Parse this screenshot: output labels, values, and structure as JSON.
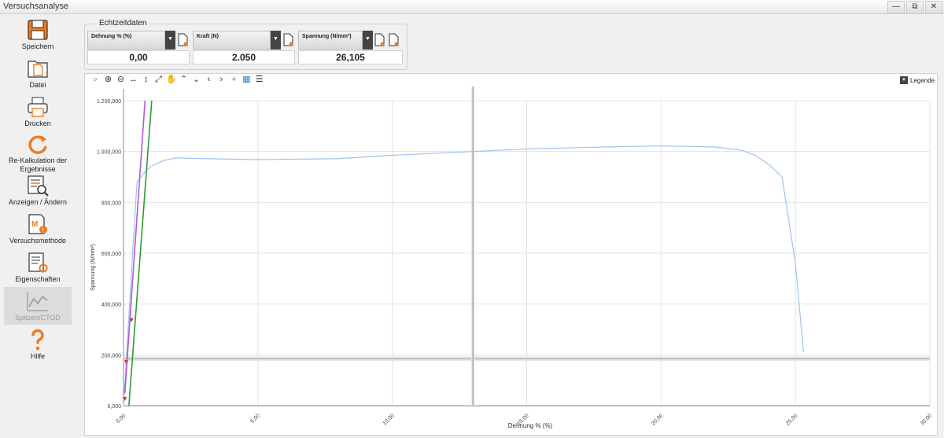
{
  "window": {
    "title": "Versuchsanalyse",
    "min": "—",
    "restore": "⧉",
    "close": "✕"
  },
  "sidebar": {
    "items": [
      {
        "label": "Speichern",
        "icon": "save-icon"
      },
      {
        "label": "Datei",
        "icon": "file-icon"
      },
      {
        "label": "Drucken",
        "icon": "print-icon"
      },
      {
        "label": "Re-Kalkulation der Ergebnisse",
        "icon": "recalc-icon"
      },
      {
        "label": "Anzeigen / Ändern",
        "icon": "view-edit-icon"
      },
      {
        "label": "Versuchsmethode",
        "icon": "method-icon"
      },
      {
        "label": "Eigenschaften",
        "icon": "properties-icon"
      },
      {
        "label": "Spitzen/CTOD",
        "icon": "peaks-icon",
        "selected": true
      },
      {
        "label": "Hilfe",
        "icon": "help-icon"
      }
    ]
  },
  "realtime": {
    "title": "Echtzeitdaten",
    "meters": [
      {
        "label": "Dehnung % (%)",
        "value": "0,00"
      },
      {
        "label": "Kraft (N)",
        "value": "2.050"
      },
      {
        "label": "Spannung (N/mm²)",
        "value": "26,105"
      }
    ]
  },
  "toolbar": {
    "icons": [
      "zoom-icon",
      "zoom-in-icon",
      "zoom-out-icon",
      "fit-horizontal-icon",
      "fit-vertical-icon",
      "fit-all-icon",
      "pan-icon",
      "scroll-up-icon",
      "scroll-down-icon",
      "scroll-left-icon",
      "scroll-right-icon",
      "crosshair-icon",
      "grid-icon",
      "list-icon"
    ],
    "legend_label": "Legende"
  },
  "chart_data": {
    "type": "line",
    "xlabel": "Dehnung % (%)",
    "ylabel": "Spannung (N/mm²)",
    "xlim": [
      0,
      30
    ],
    "ylim": [
      0,
      1200
    ],
    "xticks": [
      "0,00",
      "5,00",
      "10,00",
      "15,00",
      "20,00",
      "25,00",
      "30,00"
    ],
    "yticks": [
      "0,000",
      "200,000",
      "400,000",
      "600,000",
      "800,000",
      "1.000,000",
      "1.200,000"
    ],
    "grid": true,
    "series": [
      {
        "color": "#9cc3ef",
        "x": [
          0,
          0.5,
          0.8,
          1.0,
          1.5,
          2.0,
          2.5,
          3.0,
          5.0,
          8.0,
          10.0,
          13.0,
          15.0,
          18.0,
          20.0,
          22.0,
          23.0,
          23.5,
          24.0,
          24.5,
          25.0,
          25.3
        ],
        "y": [
          0,
          880,
          920,
          940,
          965,
          975,
          973,
          972,
          968,
          972,
          985,
          1000,
          1010,
          1018,
          1022,
          1018,
          1005,
          985,
          950,
          900,
          560,
          210
        ]
      },
      {
        "color": "#2e9b36",
        "x": [
          0.2,
          1.05
        ],
        "y": [
          0,
          1200
        ]
      },
      {
        "color": "#b05ad8",
        "x": [
          0.05,
          0.8
        ],
        "y": [
          50,
          1200
        ]
      }
    ],
    "markers": [
      {
        "x": 0.05,
        "y": 25,
        "color": "#d03030"
      },
      {
        "x": 0.1,
        "y": 170,
        "color": "#d03030"
      },
      {
        "x": 0.3,
        "y": 335,
        "color": "#d03030"
      }
    ],
    "cursor_x": 13.0,
    "hline_y": 185
  },
  "colors": {
    "accent": "#f07a1e",
    "selected_bg": "#dcdcdc"
  }
}
